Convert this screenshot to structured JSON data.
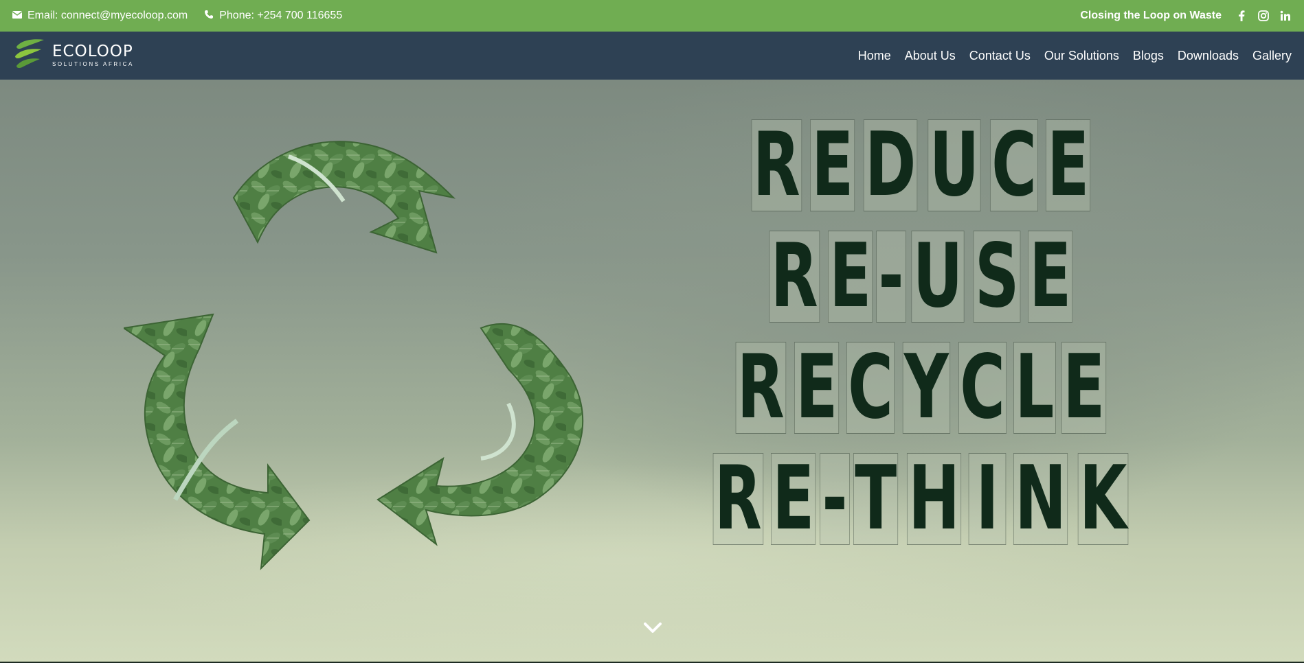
{
  "topbar": {
    "email": "Email: connect@myecoloop.com",
    "phone": "Phone: +254 700 116655",
    "tagline": "Closing the Loop on Waste",
    "social": [
      "facebook-icon",
      "instagram-icon",
      "linkedin-icon"
    ],
    "background": "#70ad52"
  },
  "brand": {
    "name": "ECOLOOP",
    "subtitle": "SOLUTIONS AFRICA"
  },
  "nav": {
    "items": [
      "Home",
      "About Us",
      "Contact Us",
      "Our Solutions",
      "Blogs",
      "Downloads",
      "Gallery"
    ],
    "background": "#2e4154"
  },
  "hero": {
    "words": [
      "REDUCE",
      "RE-USE",
      "RECYCLE",
      "RE-THINK"
    ],
    "scroll_icon": "chevron-down-icon",
    "leaf_color": "#5f8f54"
  }
}
